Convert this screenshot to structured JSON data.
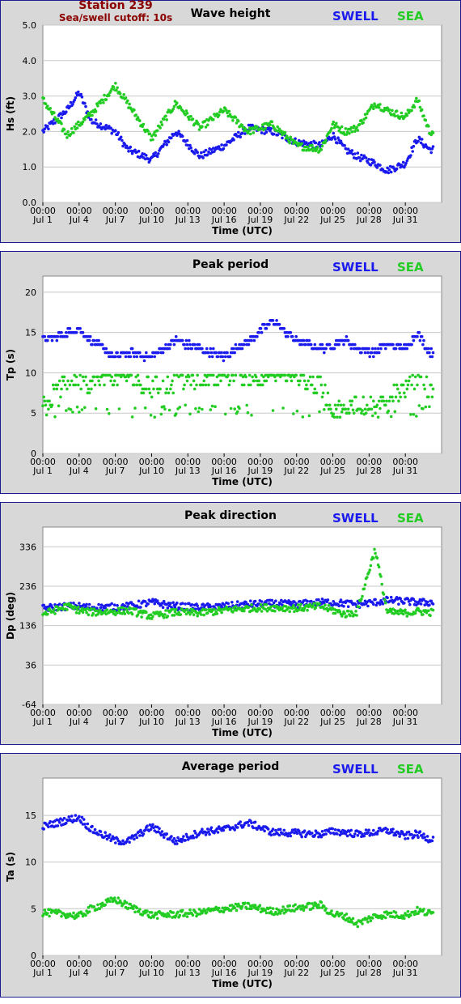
{
  "header": {
    "station": "Station 239",
    "cutoff": "Sea/swell cutoff: 10s"
  },
  "colors": {
    "swell": "#1a1aee",
    "sea": "#22cc22",
    "frame": "#1c1c8c",
    "station": "#8b0000"
  },
  "chart_data": [
    {
      "type": "scatter",
      "title": "Wave height",
      "ylabel": "Hs (ft)",
      "xlabel": "Time (UTC)",
      "ylim": [
        0,
        5
      ],
      "yticks": [
        "0.0",
        "1.0",
        "2.0",
        "3.0",
        "4.0",
        "5.0"
      ],
      "xticks": [
        "00:00\nJul 1",
        "00:00\nJul 4",
        "00:00\nJul 7",
        "00:00\nJul 10",
        "00:00\nJul 13",
        "00:00\nJul 16",
        "00:00\nJul 19",
        "00:00\nJul 22",
        "00:00\nJul 25",
        "00:00\nJul 28",
        "00:00\nJul 31"
      ],
      "legend": [
        "SWELL",
        "SEA"
      ],
      "x": [
        0,
        2,
        3,
        4,
        6,
        7,
        9,
        11,
        13,
        15,
        17,
        19,
        21,
        23,
        24,
        25,
        26,
        27.5,
        28.5,
        30,
        31,
        32
      ],
      "series": [
        {
          "name": "SWELL",
          "values": [
            2.0,
            2.6,
            3.1,
            2.3,
            2.0,
            1.5,
            1.2,
            2.0,
            1.3,
            1.6,
            2.1,
            2.0,
            1.7,
            1.6,
            1.9,
            1.5,
            1.3,
            1.1,
            0.9,
            1.1,
            1.8,
            1.5
          ]
        },
        {
          "name": "SEA",
          "values": [
            2.9,
            1.9,
            2.2,
            2.5,
            3.3,
            2.8,
            1.8,
            2.8,
            2.1,
            2.6,
            2.0,
            2.2,
            1.6,
            1.5,
            2.2,
            2.0,
            2.1,
            2.8,
            2.6,
            2.4,
            2.9,
            2.0
          ]
        }
      ]
    },
    {
      "type": "scatter",
      "title": "Peak period",
      "ylabel": "Tp (s)",
      "xlabel": "Time (UTC)",
      "ylim": [
        0,
        22
      ],
      "yticks": [
        "0",
        "5",
        "10",
        "15",
        "20"
      ],
      "xticks": [
        "00:00\nJul 1",
        "00:00\nJul 4",
        "00:00\nJul 7",
        "00:00\nJul 10",
        "00:00\nJul 13",
        "00:00\nJul 16",
        "00:00\nJul 19",
        "00:00\nJul 22",
        "00:00\nJul 25",
        "00:00\nJul 28",
        "00:00\nJul 31"
      ],
      "legend": [
        "SWELL",
        "SEA"
      ],
      "x": [
        0,
        2,
        3,
        4,
        6,
        7,
        9,
        11,
        13,
        15,
        17,
        19,
        21,
        23,
        24,
        25,
        26,
        27.5,
        28.5,
        30,
        31,
        32
      ],
      "series": [
        {
          "name": "SWELL",
          "values": [
            14,
            15,
            15.4,
            14,
            12,
            12.5,
            12,
            14,
            13,
            12,
            14,
            16.5,
            14,
            13,
            13.5,
            14,
            13,
            12.5,
            13.5,
            13,
            15,
            12.5
          ]
        },
        {
          "name": "SEA",
          "values": [
            6,
            9,
            9.5,
            8.5,
            9.7,
            9.7,
            8,
            9,
            9.5,
            9.7,
            9.5,
            9.7,
            9.7,
            8,
            6,
            5,
            6.5,
            5.5,
            7,
            8,
            9,
            8
          ]
        }
      ]
    },
    {
      "type": "scatter",
      "title": "Peak direction",
      "ylabel": "Dp (deg)",
      "xlabel": "Time (UTC)",
      "ylim": [
        -64,
        386
      ],
      "yticks": [
        "-64",
        "36",
        "136",
        "236",
        "336"
      ],
      "xticks": [
        "00:00\nJul 1",
        "00:00\nJul 4",
        "00:00\nJul 7",
        "00:00\nJul 10",
        "00:00\nJul 13",
        "00:00\nJul 16",
        "00:00\nJul 19",
        "00:00\nJul 22",
        "00:00\nJul 25",
        "00:00\nJul 28",
        "00:00\nJul 31"
      ],
      "legend": [
        "SWELL",
        "SEA"
      ],
      "x": [
        0,
        2,
        3,
        4,
        6,
        7,
        9,
        11,
        13,
        15,
        17,
        19,
        21,
        23,
        24,
        25,
        26,
        27.5,
        28.5,
        30,
        31,
        32
      ],
      "series": [
        {
          "name": "SWELL",
          "values": [
            180,
            185,
            185,
            182,
            183,
            185,
            195,
            185,
            182,
            185,
            190,
            192,
            190,
            195,
            195,
            192,
            190,
            195,
            200,
            198,
            195,
            195
          ]
        },
        {
          "name": "SEA",
          "values": [
            165,
            185,
            175,
            170,
            172,
            175,
            160,
            170,
            168,
            175,
            180,
            182,
            180,
            185,
            175,
            165,
            170,
            330,
            170,
            168,
            172,
            170
          ]
        }
      ]
    },
    {
      "type": "scatter",
      "title": "Average period",
      "ylabel": "Ta (s)",
      "xlabel": "Time (UTC)",
      "ylim": [
        0,
        19
      ],
      "yticks": [
        "0",
        "5",
        "10",
        "15"
      ],
      "xticks": [
        "00:00\nJul 1",
        "00:00\nJul 4",
        "00:00\nJul 7",
        "00:00\nJul 10",
        "00:00\nJul 13",
        "00:00\nJul 16",
        "00:00\nJul 19",
        "00:00\nJul 22",
        "00:00\nJul 25",
        "00:00\nJul 28",
        "00:00\nJul 31"
      ],
      "legend": [
        "SWELL",
        "SEA"
      ],
      "x": [
        0,
        2,
        3,
        4,
        6,
        7,
        9,
        11,
        13,
        15,
        17,
        19,
        21,
        23,
        24,
        25,
        26,
        27.5,
        28.5,
        30,
        31,
        32
      ],
      "series": [
        {
          "name": "SWELL",
          "values": [
            13.8,
            14.5,
            14.8,
            13.5,
            12.3,
            12.2,
            13.8,
            12.2,
            13.2,
            13.5,
            14.2,
            13.2,
            13.1,
            13.0,
            13.3,
            13.2,
            13.0,
            13.2,
            13.4,
            12.8,
            13.0,
            12.5
          ]
        },
        {
          "name": "SEA",
          "values": [
            4.6,
            4.4,
            4.2,
            5.0,
            6.0,
            5.3,
            4.3,
            4.4,
            4.6,
            5.0,
            5.3,
            4.7,
            5.1,
            5.4,
            4.4,
            4.2,
            3.4,
            4.2,
            4.4,
            4.3,
            4.8,
            4.5
          ]
        }
      ]
    }
  ]
}
